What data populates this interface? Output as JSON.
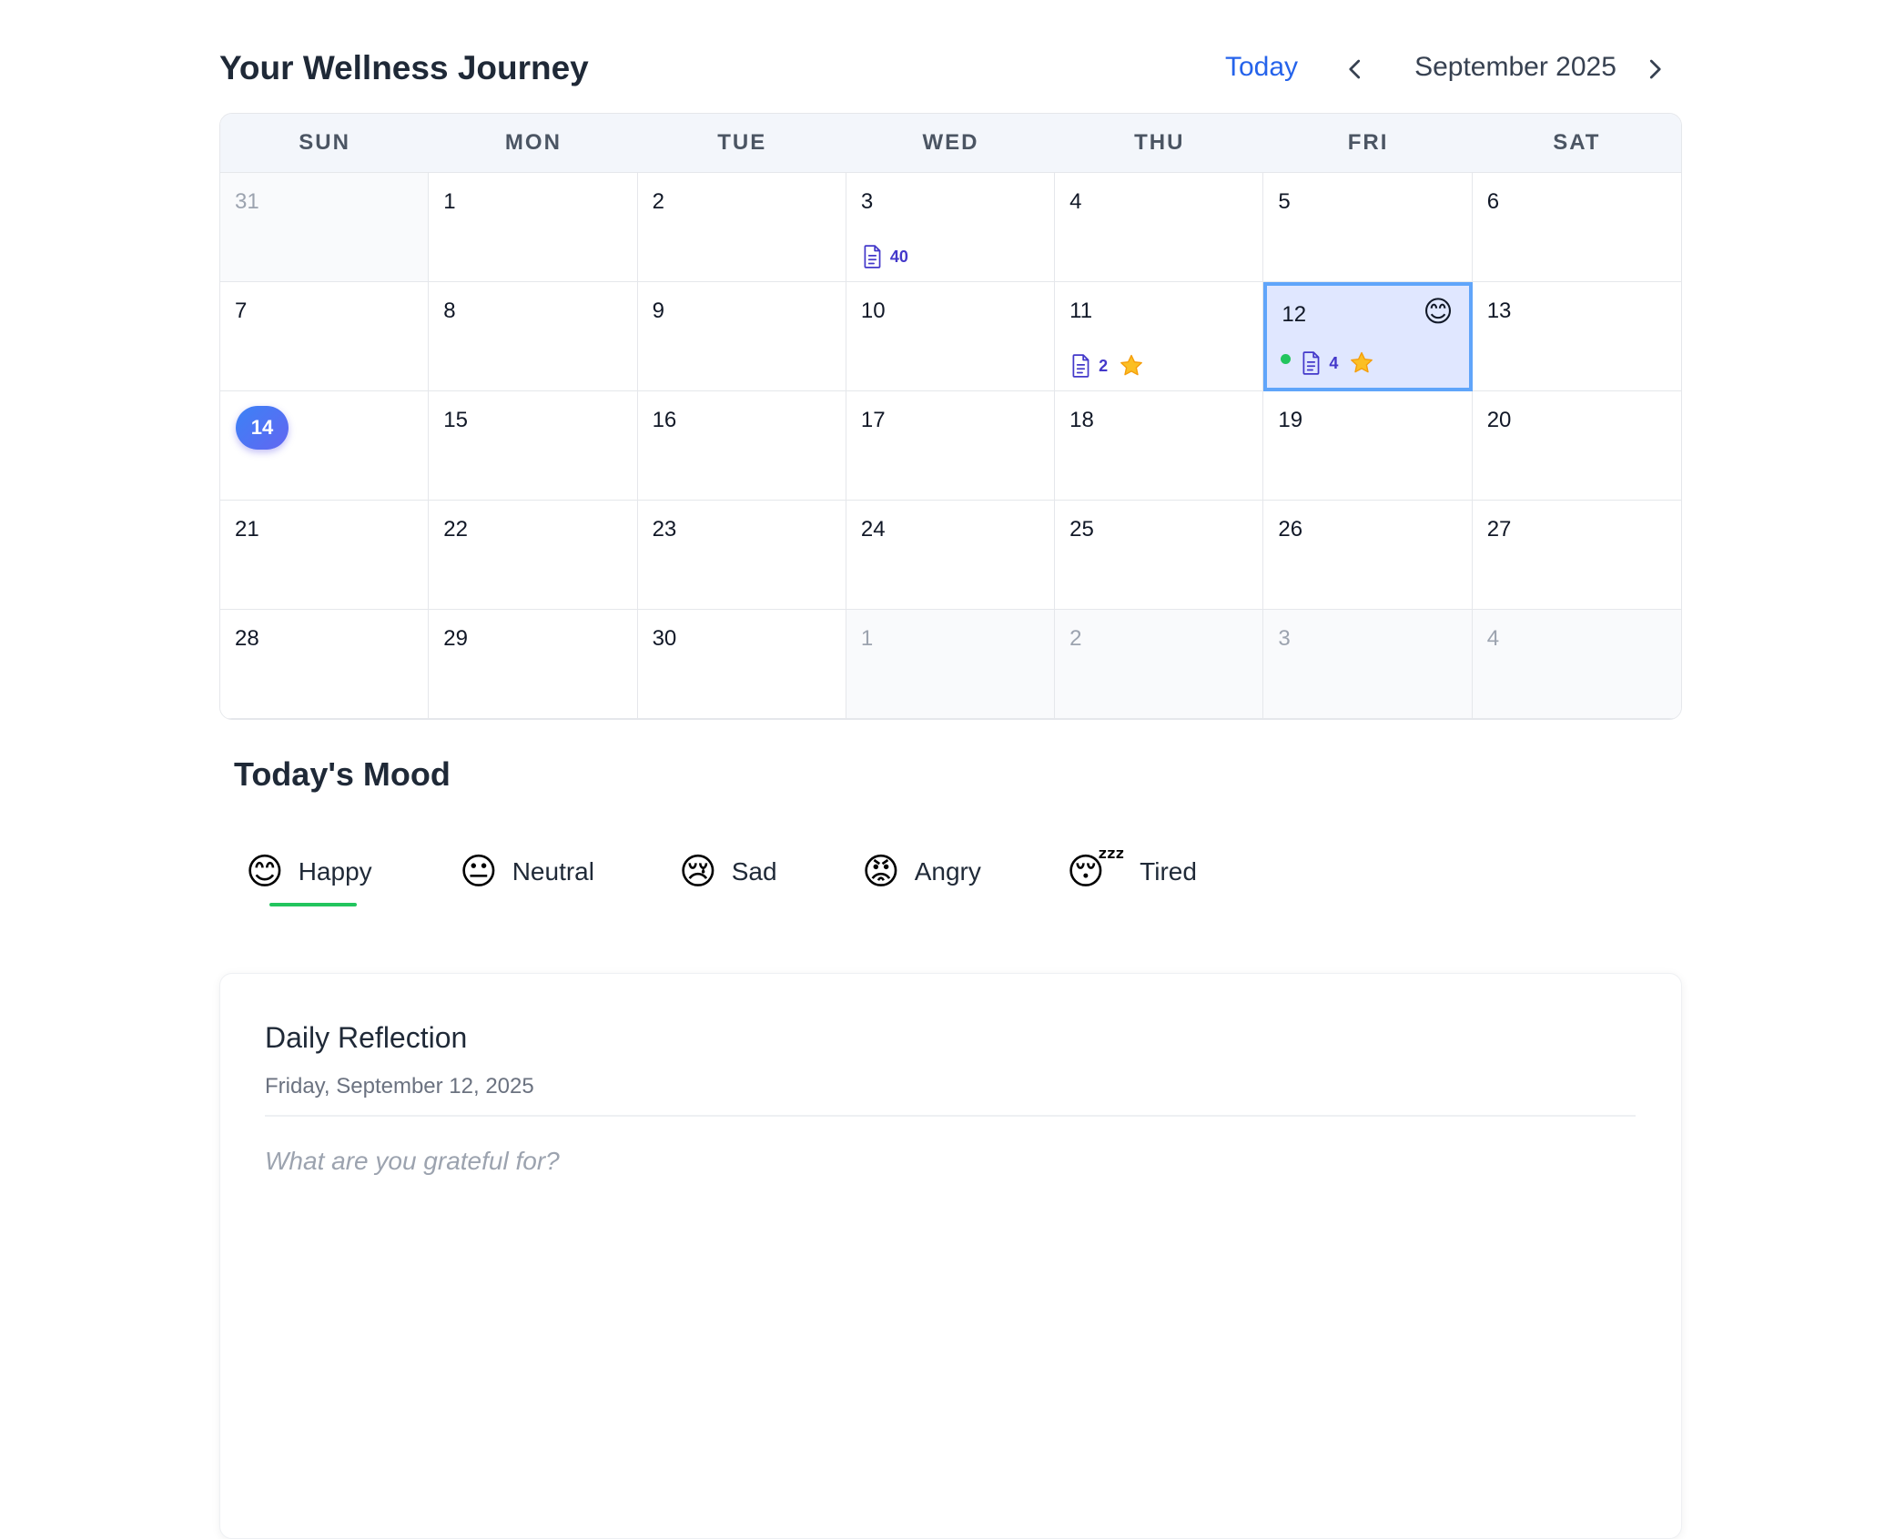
{
  "header": {
    "title": "Your Wellness Journey",
    "today_label": "Today",
    "month_label": "September 2025",
    "prev_icon": "chevron-left-icon",
    "next_icon": "chevron-right-icon"
  },
  "calendar": {
    "weekdays": [
      "SUN",
      "MON",
      "TUE",
      "WED",
      "THU",
      "FRI",
      "SAT"
    ],
    "days": [
      {
        "day": "31",
        "muted": true
      },
      {
        "day": "1"
      },
      {
        "day": "2"
      },
      {
        "day": "3",
        "entries": "40"
      },
      {
        "day": "4"
      },
      {
        "day": "5"
      },
      {
        "day": "6"
      },
      {
        "day": "7"
      },
      {
        "day": "8"
      },
      {
        "day": "9"
      },
      {
        "day": "10"
      },
      {
        "day": "11",
        "entries": "2",
        "starred": true
      },
      {
        "day": "12",
        "entries": "4",
        "starred": true,
        "selected": true,
        "mood_emoji": "😊",
        "mood_dot": true
      },
      {
        "day": "13"
      },
      {
        "day": "14",
        "today": true
      },
      {
        "day": "15"
      },
      {
        "day": "16"
      },
      {
        "day": "17"
      },
      {
        "day": "18"
      },
      {
        "day": "19"
      },
      {
        "day": "20"
      },
      {
        "day": "21"
      },
      {
        "day": "22"
      },
      {
        "day": "23"
      },
      {
        "day": "24"
      },
      {
        "day": "25"
      },
      {
        "day": "26"
      },
      {
        "day": "27"
      },
      {
        "day": "28"
      },
      {
        "day": "29"
      },
      {
        "day": "30"
      },
      {
        "day": "1",
        "muted": true
      },
      {
        "day": "2",
        "muted": true
      },
      {
        "day": "3",
        "muted": true
      },
      {
        "day": "4",
        "muted": true
      }
    ],
    "icons": {
      "entries": "document-icon",
      "star": "star-icon",
      "mood_dot": "mood-indicator-dot"
    },
    "colors": {
      "accent": "#2563eb",
      "selected_bg": "#e0e7ff",
      "selected_border": "#60a5fa",
      "entry_count": "#4338ca",
      "star": "#f59e0b",
      "mood_dot": "#22c55e",
      "today_gradient_start": "#3b82f6",
      "today_gradient_end": "#6366f1"
    }
  },
  "mood": {
    "title": "Today's Mood",
    "selected": "Happy",
    "options": [
      {
        "emoji": "😊",
        "label": "Happy"
      },
      {
        "emoji": "😐",
        "label": "Neutral"
      },
      {
        "emoji": "😢",
        "label": "Sad"
      },
      {
        "emoji": "😡",
        "label": "Angry"
      },
      {
        "emoji": "😴",
        "label": "Tired"
      }
    ]
  },
  "reflection": {
    "title": "Daily Reflection",
    "date": "Friday, September 12, 2025",
    "placeholder": "What are you grateful for?",
    "value": ""
  }
}
